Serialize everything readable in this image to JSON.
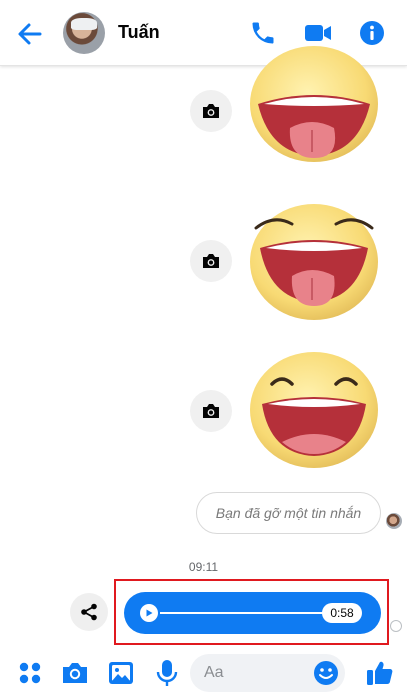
{
  "header": {
    "contact_name": "Tuấn",
    "icons": [
      "back-arrow-icon",
      "phone-icon",
      "video-camera-icon",
      "info-icon"
    ]
  },
  "messages": {
    "stickers": [
      {
        "sticker": "laughing-tongue-emoji",
        "action_icon": "camera-icon"
      },
      {
        "sticker": "laughing-tongue-emoji",
        "action_icon": "camera-icon"
      },
      {
        "sticker": "laughing-emoji",
        "action_icon": "camera-icon"
      }
    ],
    "removed_message": "Bạn đã gỡ một tin nhắn",
    "timestamp": "09:11",
    "voice_message": {
      "duration": "0:58",
      "progress": 0
    }
  },
  "composer": {
    "placeholder": "Aa"
  },
  "colors": {
    "accent": "#0F7BF2",
    "highlight_box": "#E0191F",
    "emoji_face": "#F8DA74"
  }
}
